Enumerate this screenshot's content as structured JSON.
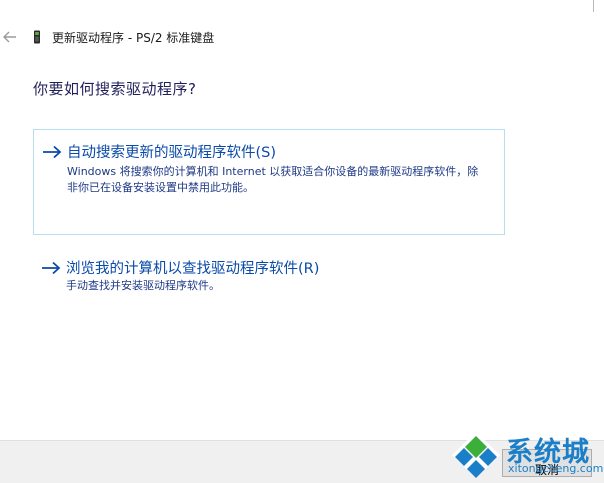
{
  "window": {
    "title": "更新驱动程序 - PS/2 标准键盘"
  },
  "main": {
    "heading": "你要如何搜索驱动程序?",
    "options": [
      {
        "title": "自动搜索更新的驱动程序软件(S)",
        "description": "Windows 将搜索你的计算机和 Internet 以获取适合你设备的最新驱动程序软件，除非你已在设备安装设置中禁用此功能。"
      },
      {
        "title": "浏览我的计算机以查找驱动程序软件(R)",
        "description": "手动查找并安装驱动程序软件。"
      }
    ]
  },
  "footer": {
    "cancel_label": "取消"
  },
  "watermark": {
    "text": "系统城",
    "url": "xitongcheng.com"
  },
  "icons": {
    "back": "back-arrow-icon",
    "device": "keyboard-device-icon",
    "option_arrow": "right-arrow-icon"
  },
  "colors": {
    "accent": "#0a4aa8",
    "heading": "#1f1f5a",
    "card_border": "#b9dcef",
    "footer_bg": "#f0f0f0",
    "watermark": "#1a7fc8"
  }
}
